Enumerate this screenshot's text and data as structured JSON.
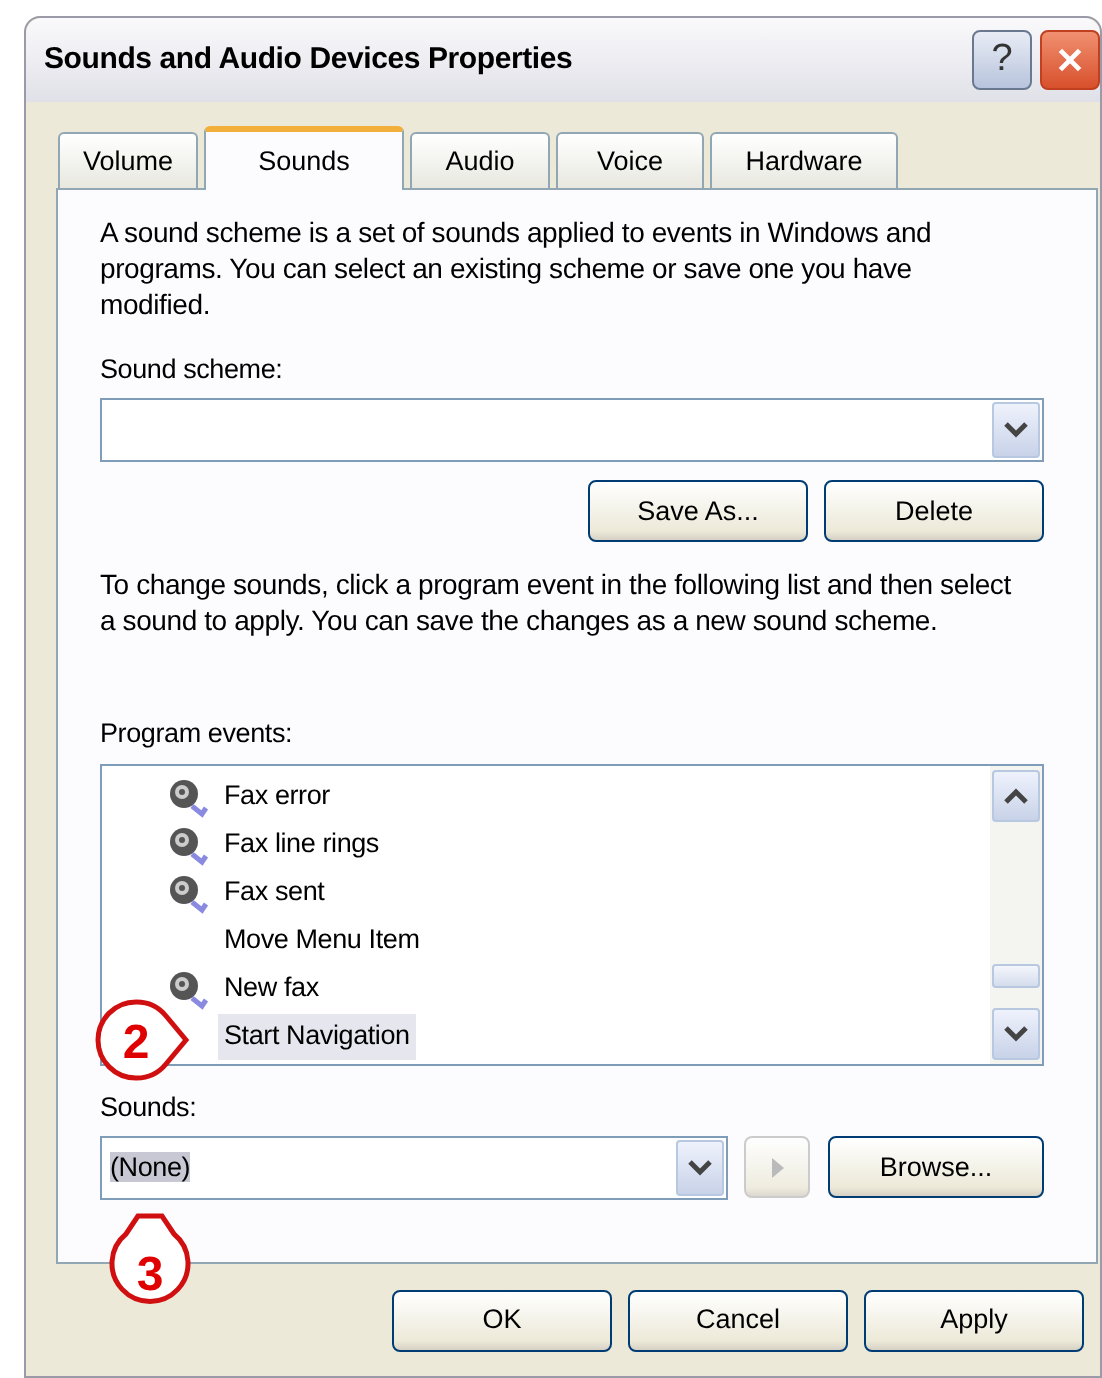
{
  "window": {
    "title": "Sounds and Audio Devices Properties",
    "help_button": "?"
  },
  "tabs": [
    {
      "label": "Volume",
      "selected": false
    },
    {
      "label": "Sounds",
      "selected": true
    },
    {
      "label": "Audio",
      "selected": false
    },
    {
      "label": "Voice",
      "selected": false
    },
    {
      "label": "Hardware",
      "selected": false
    }
  ],
  "scheme_intro": "A sound scheme is a set of sounds applied to events in Windows and programs. You can select an existing scheme or save one you have modified.",
  "scheme_label": "Sound scheme:",
  "scheme_buttons": [
    "Save As...",
    "Delete"
  ],
  "events_intro": "To change sounds, click a program event in the following list and then select a sound to apply. You can save the changes as a new sound scheme.",
  "events_label": "Program events:",
  "events": [
    {
      "name": "Fax error",
      "has_sound": true,
      "selected": false
    },
    {
      "name": "Fax line rings",
      "has_sound": true,
      "selected": false
    },
    {
      "name": "Fax sent",
      "has_sound": true,
      "selected": false
    },
    {
      "name": "Move Menu Item",
      "has_sound": false,
      "selected": false
    },
    {
      "name": "New fax",
      "has_sound": true,
      "selected": false
    },
    {
      "name": "Start Navigation",
      "has_sound": false,
      "selected": true
    }
  ],
  "sounds_label": "Sounds:",
  "sound_value": "(None)",
  "sound_value_highlighted": true,
  "browse_button": "Browse...",
  "dialog_buttons": [
    "OK",
    "Cancel",
    "Apply"
  ],
  "callouts": [
    {
      "label": "2",
      "kind": "right"
    },
    {
      "label": "3",
      "kind": "up"
    }
  ]
}
